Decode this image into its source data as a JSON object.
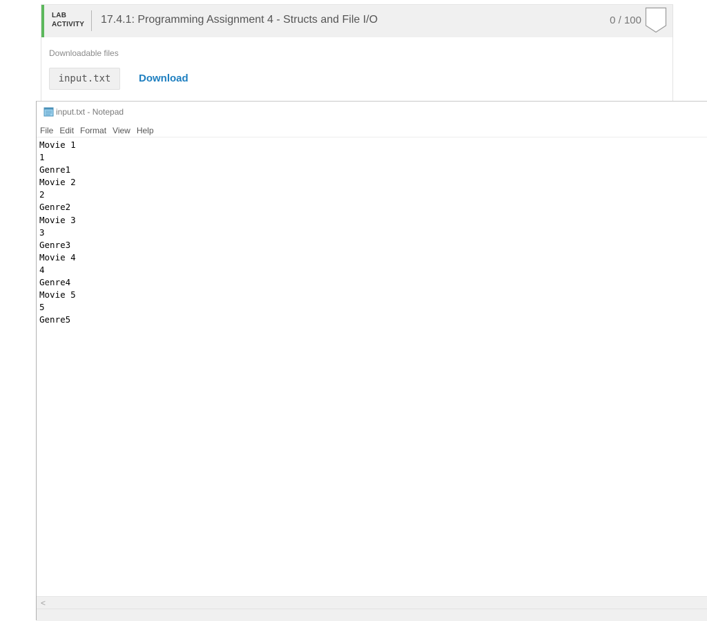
{
  "lab_activity": {
    "tag_line1": "LAB",
    "tag_line2": "ACTIVITY",
    "title": "17.4.1: Programming Assignment 4 - Structs and File I/O",
    "score": "0 / 100",
    "accent_color": "#5cb85c",
    "status_icon": "shield-outline-icon",
    "downloadable_caption": "Downloadable files",
    "file_name": "input.txt",
    "download_label": "Download",
    "link_color": "#1e7fc0"
  },
  "notepad": {
    "title": "input.txt - Notepad",
    "app_icon": "notepad-icon",
    "menu": [
      "File",
      "Edit",
      "Format",
      "View",
      "Help"
    ],
    "content_lines": [
      "Movie 1",
      "1",
      "Genre1",
      "Movie 2",
      "2",
      "Genre2",
      "Movie 3",
      "3",
      "Genre3",
      "Movie 4",
      "4",
      "Genre4",
      "Movie 5",
      "5",
      "Genre5"
    ],
    "scroll_left_glyph": "<"
  }
}
